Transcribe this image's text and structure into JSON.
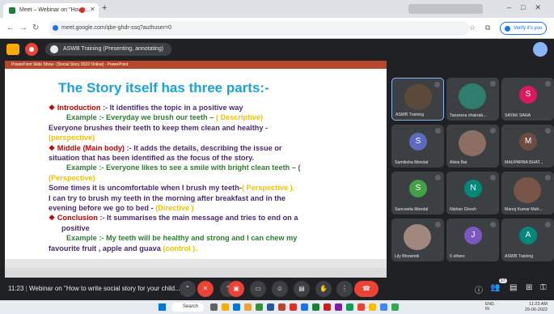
{
  "browser": {
    "tab_title": "Meet – Webinar on \"How t...",
    "new_tab": "+",
    "url": "meet.google.com/qbe-ghdr-ssq?authuser=0",
    "verify_label": "Verify it's you"
  },
  "meet": {
    "presenter_label": "ASWB Training (Presenting, annotating)",
    "time": "11:23",
    "meeting_title": "Webinar on \"How to write social story for your child..."
  },
  "slide": {
    "window_title": "PowerPoint Slide Show - [Social Story 2022 Online] - PowerPoint",
    "title": "The Story itself has three parts:-",
    "lines": [
      {
        "bullet": "❖ ",
        "label": "Introduction",
        "text": " :- It identifies the topic in a positive way"
      },
      {
        "ex_label": "Example",
        "text": " :- Everyday we brush our teeth – ",
        "tag": "( Descriptive)"
      },
      {
        "text": "Everyone brushes their teeth to keep them clean and healthy -"
      },
      {
        "tag": "(perspective)"
      },
      {
        "bullet": "❖ ",
        "label": "Middle (Main body)",
        "text": " :- It adds the details, describing the issue or"
      },
      {
        "text": "situation that has been identified as the focus of the story."
      },
      {
        "ex_label": "Example",
        "text": " :- Everyone likes to see a smile with bright clean teeth – ("
      },
      {
        "tag": "(Perspective)"
      },
      {
        "text": "Some times it is uncomfortable when I brush my teeth-",
        "tag": "( Perspective )."
      },
      {
        "text": "I can try to brush my teeth in the morning after breakfast and in the"
      },
      {
        "text": "evening before we go to bed - ",
        "tag": "(Directive )"
      },
      {
        "bullet": "❖ ",
        "label": "Conclusion",
        "text": " :- It summarises the main message and tries to end on a"
      },
      {
        "text": "positive"
      },
      {
        "ex_label": "Example",
        "text": " :-  My teeth will be healthy and strong and I can chew my"
      },
      {
        "text": "favourite fruit , apple and guava ",
        "tag": "(control )."
      }
    ]
  },
  "participants": [
    {
      "name": "ASWB Training",
      "initial": "",
      "color": "#5b4a3a",
      "photo": true
    },
    {
      "name": "Tanzeera chakrab...",
      "initial": "",
      "color": "#2e7d6e",
      "photo": true
    },
    {
      "name": "SAYAK SAHA",
      "initial": "S",
      "color": "#d81b60",
      "photo": false
    },
    {
      "name": "Samiksha Mondal",
      "initial": "S",
      "color": "#5c6bc0",
      "photo": false
    },
    {
      "name": "Alivia Bar",
      "initial": "",
      "color": "#8d6e63",
      "photo": true
    },
    {
      "name": "MAUPARNA BHAT...",
      "initial": "M",
      "color": "#6d4c41",
      "photo": false
    },
    {
      "name": "Sancweta Mondal",
      "initial": "S",
      "color": "#43a047",
      "photo": false
    },
    {
      "name": "Nishan Ghosh",
      "initial": "N",
      "color": "#00897b",
      "photo": false
    },
    {
      "name": "Manoj Kumar Mah...",
      "initial": "",
      "color": "#795548",
      "photo": true
    },
    {
      "name": "Lily Bhowmik",
      "initial": "",
      "color": "#a1887f",
      "photo": true
    },
    {
      "name": "5 others",
      "initial": "J",
      "color": "#7e57c2",
      "photo": false
    },
    {
      "name": "ASWB Training",
      "initial": "A",
      "color": "#00897b",
      "photo": false
    }
  ],
  "meetbar_badge": "17",
  "taskbar": {
    "search_label": "Search",
    "lang": "ENG\nIN",
    "clock_time": "11:23 AM",
    "clock_date": "29-06-2022"
  }
}
